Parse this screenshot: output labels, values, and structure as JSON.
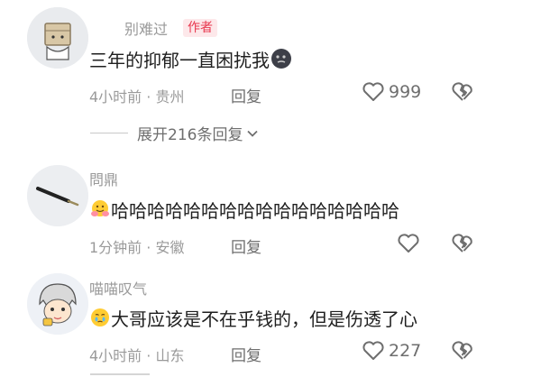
{
  "comments": [
    {
      "username": "别难过",
      "author_tag": "作者",
      "text": "三年的抑郁一直困扰我",
      "time": "4小时前",
      "location": "贵州",
      "reply_label": "回复",
      "like_count": "999",
      "expand_label": "展开216条回复"
    },
    {
      "username": "問鼎",
      "text": "哈哈哈哈哈哈哈哈哈哈哈哈哈哈哈哈",
      "time": "1分钟前",
      "location": "安徽",
      "reply_label": "回复"
    },
    {
      "username": "喵喵叹气",
      "text": "大哥应该是不在乎钱的，但是伤透了心",
      "time": "4小时前",
      "location": "山东",
      "reply_label": "回复",
      "like_count": "227"
    }
  ],
  "separator": "·",
  "colors": {
    "author_tag_bg": "#fde8ea",
    "author_tag_text": "#e8384f",
    "meta": "#9a9a9a"
  },
  "icons": [
    "heart-outline-icon",
    "broken-heart-icon",
    "chevron-down-icon",
    "dark-moon-emoji",
    "hug-emoji",
    "crying-emoji"
  ]
}
